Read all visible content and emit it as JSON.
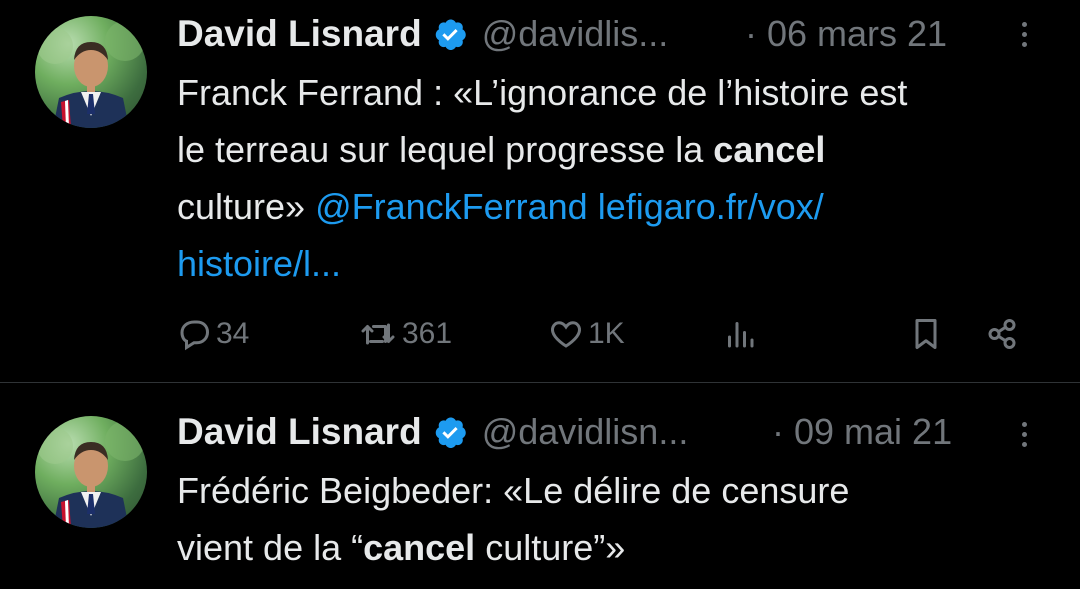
{
  "tweets": [
    {
      "author_name": "David Lisnard",
      "handle": "@davidlis...",
      "date": "· 06 mars 21",
      "text_1": "Franck Ferrand : «L’ignorance de l’histoire est",
      "text_2": "le terreau sur lequel progresse la ",
      "text_bold": "cancel",
      "text_3": "culture» ",
      "mention": "@FranckFerrand",
      "link_1": "lefigaro.fr/vox/",
      "link_2": "histoire/l...",
      "replies": "34",
      "retweets": "361",
      "likes": "1K",
      "icons": [
        "reply-icon",
        "retweet-icon",
        "like-icon",
        "views-icon",
        "bookmark-icon",
        "share-icon"
      ]
    },
    {
      "author_name": "David Lisnard",
      "handle": "@davidlisn...",
      "date": "· 09 mai 21",
      "text_1": "Frédéric Beigbeder: «Le délire de censure",
      "text_2": "vient de la “",
      "text_bold": "cancel",
      "text_3": " culture”»"
    }
  ],
  "colors": {
    "background": "#000000",
    "text": "#e7e9ea",
    "secondary": "#71767b",
    "link": "#1d9bf0",
    "verified": "#1d9bf0",
    "divider": "#2f3336"
  }
}
